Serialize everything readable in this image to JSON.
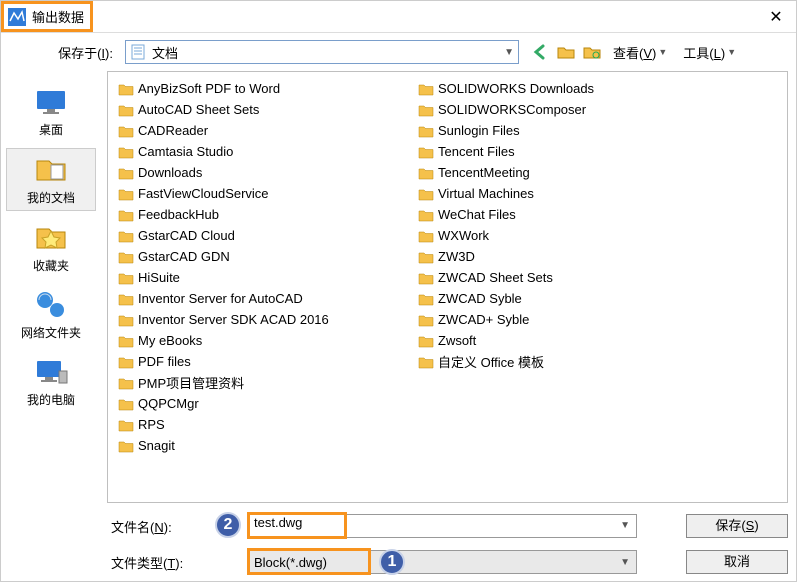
{
  "window": {
    "title": "输出数据"
  },
  "toolbar": {
    "savein_label": "保存于(I):",
    "savein_value": "文档",
    "view_label": "查看(V)",
    "tools_label": "工具(L)"
  },
  "sidebar": {
    "items": [
      {
        "label": "桌面"
      },
      {
        "label": "我的文档"
      },
      {
        "label": "收藏夹"
      },
      {
        "label": "网络文件夹"
      },
      {
        "label": "我的电脑"
      }
    ]
  },
  "files": {
    "col1": [
      "AnyBizSoft PDF to Word",
      "AutoCAD Sheet Sets",
      "CADReader",
      "Camtasia Studio",
      "Downloads",
      "FastViewCloudService",
      "FeedbackHub",
      "GstarCAD Cloud",
      "GstarCAD GDN",
      "HiSuite",
      "Inventor Server for AutoCAD",
      "Inventor Server SDK ACAD 2016",
      "My eBooks",
      "PDF files",
      "PMP项目管理资料",
      "QQPCMgr",
      "RPS",
      "Snagit"
    ],
    "col2": [
      "SOLIDWORKS Downloads",
      "SOLIDWORKSComposer",
      "Sunlogin Files",
      "Tencent Files",
      "TencentMeeting",
      "Virtual Machines",
      "WeChat Files",
      "WXWork",
      "ZW3D",
      "ZWCAD Sheet Sets",
      "ZWCAD Syble",
      "ZWCAD+ Syble",
      "Zwsoft",
      "自定义 Office 模板"
    ]
  },
  "bottom": {
    "filename_label": "文件名(N):",
    "filename_value": "test.dwg",
    "filetype_label": "文件类型(T):",
    "filetype_value": "Block(*.dwg)",
    "save_btn": "保存(S)",
    "cancel_btn": "取消"
  },
  "annotations": {
    "badge1": "1",
    "badge2": "2"
  },
  "colors": {
    "highlight": "#F7931E",
    "badge": "#3f5ea8"
  }
}
